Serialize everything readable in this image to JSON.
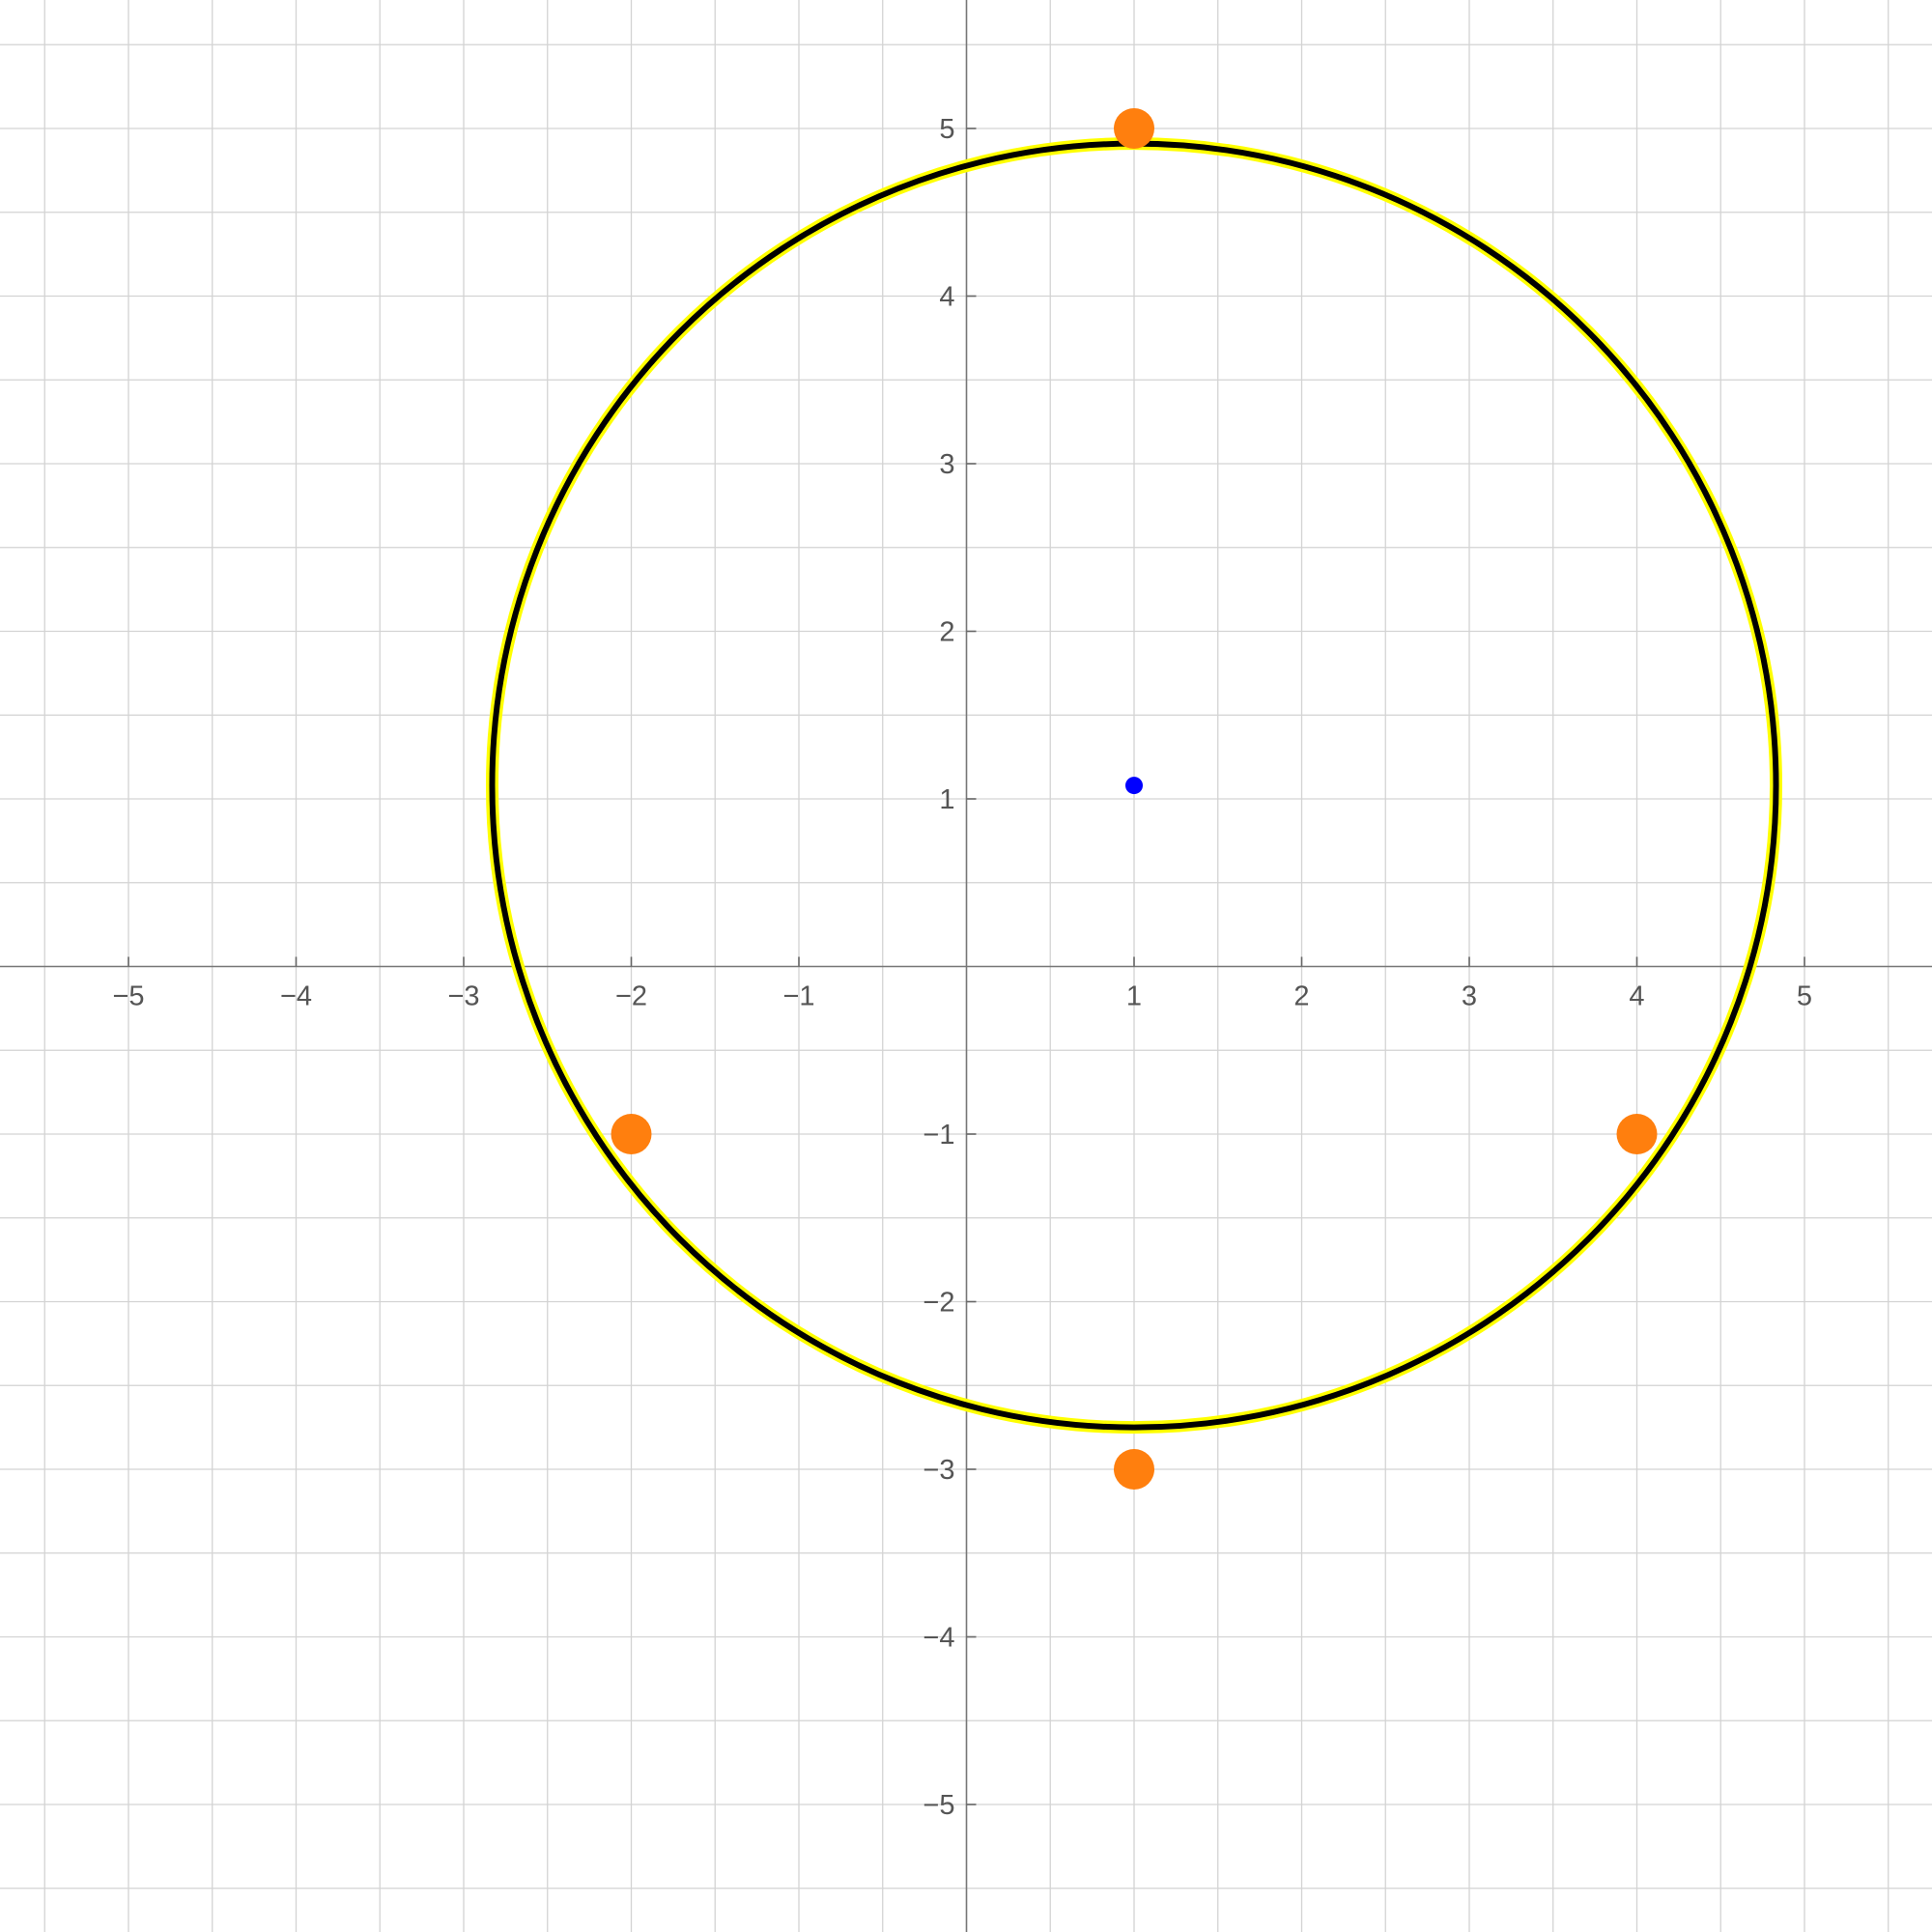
{
  "chart_data": {
    "type": "scatter",
    "title": "",
    "xlabel": "",
    "ylabel": "",
    "xlim": [
      -5.75,
      5.75
    ],
    "ylim": [
      -5.75,
      5.75
    ],
    "grid": true,
    "grid_step": 0.5,
    "x_ticks": [
      -5,
      -4,
      -3,
      -2,
      -1,
      1,
      2,
      3,
      4,
      5
    ],
    "y_ticks": [
      -5,
      -4,
      -3,
      -2,
      -1,
      1,
      2,
      3,
      4,
      5
    ],
    "x_tick_labels": [
      "−5",
      "−4",
      "−3",
      "−2",
      "−1",
      "1",
      "2",
      "3",
      "4",
      "5"
    ],
    "y_tick_labels": [
      "−5",
      "−4",
      "−3",
      "−2",
      "−1",
      "1",
      "2",
      "3",
      "4",
      "5"
    ],
    "series": [
      {
        "points": [
          {
            "x": 1,
            "y": 5
          },
          {
            "x": -2,
            "y": -1
          },
          {
            "x": 4,
            "y": -1
          },
          {
            "x": 1,
            "y": -3
          }
        ],
        "color": "#ff7f0e"
      },
      {
        "points": [
          {
            "x": 1,
            "y": 1.08
          }
        ],
        "color": "#0000ff"
      }
    ],
    "circle": {
      "center": {
        "x": 1,
        "y": 1.08
      },
      "radius": 3.83,
      "stroke_color": "#000000",
      "highlight_color": "#ffff00"
    }
  }
}
